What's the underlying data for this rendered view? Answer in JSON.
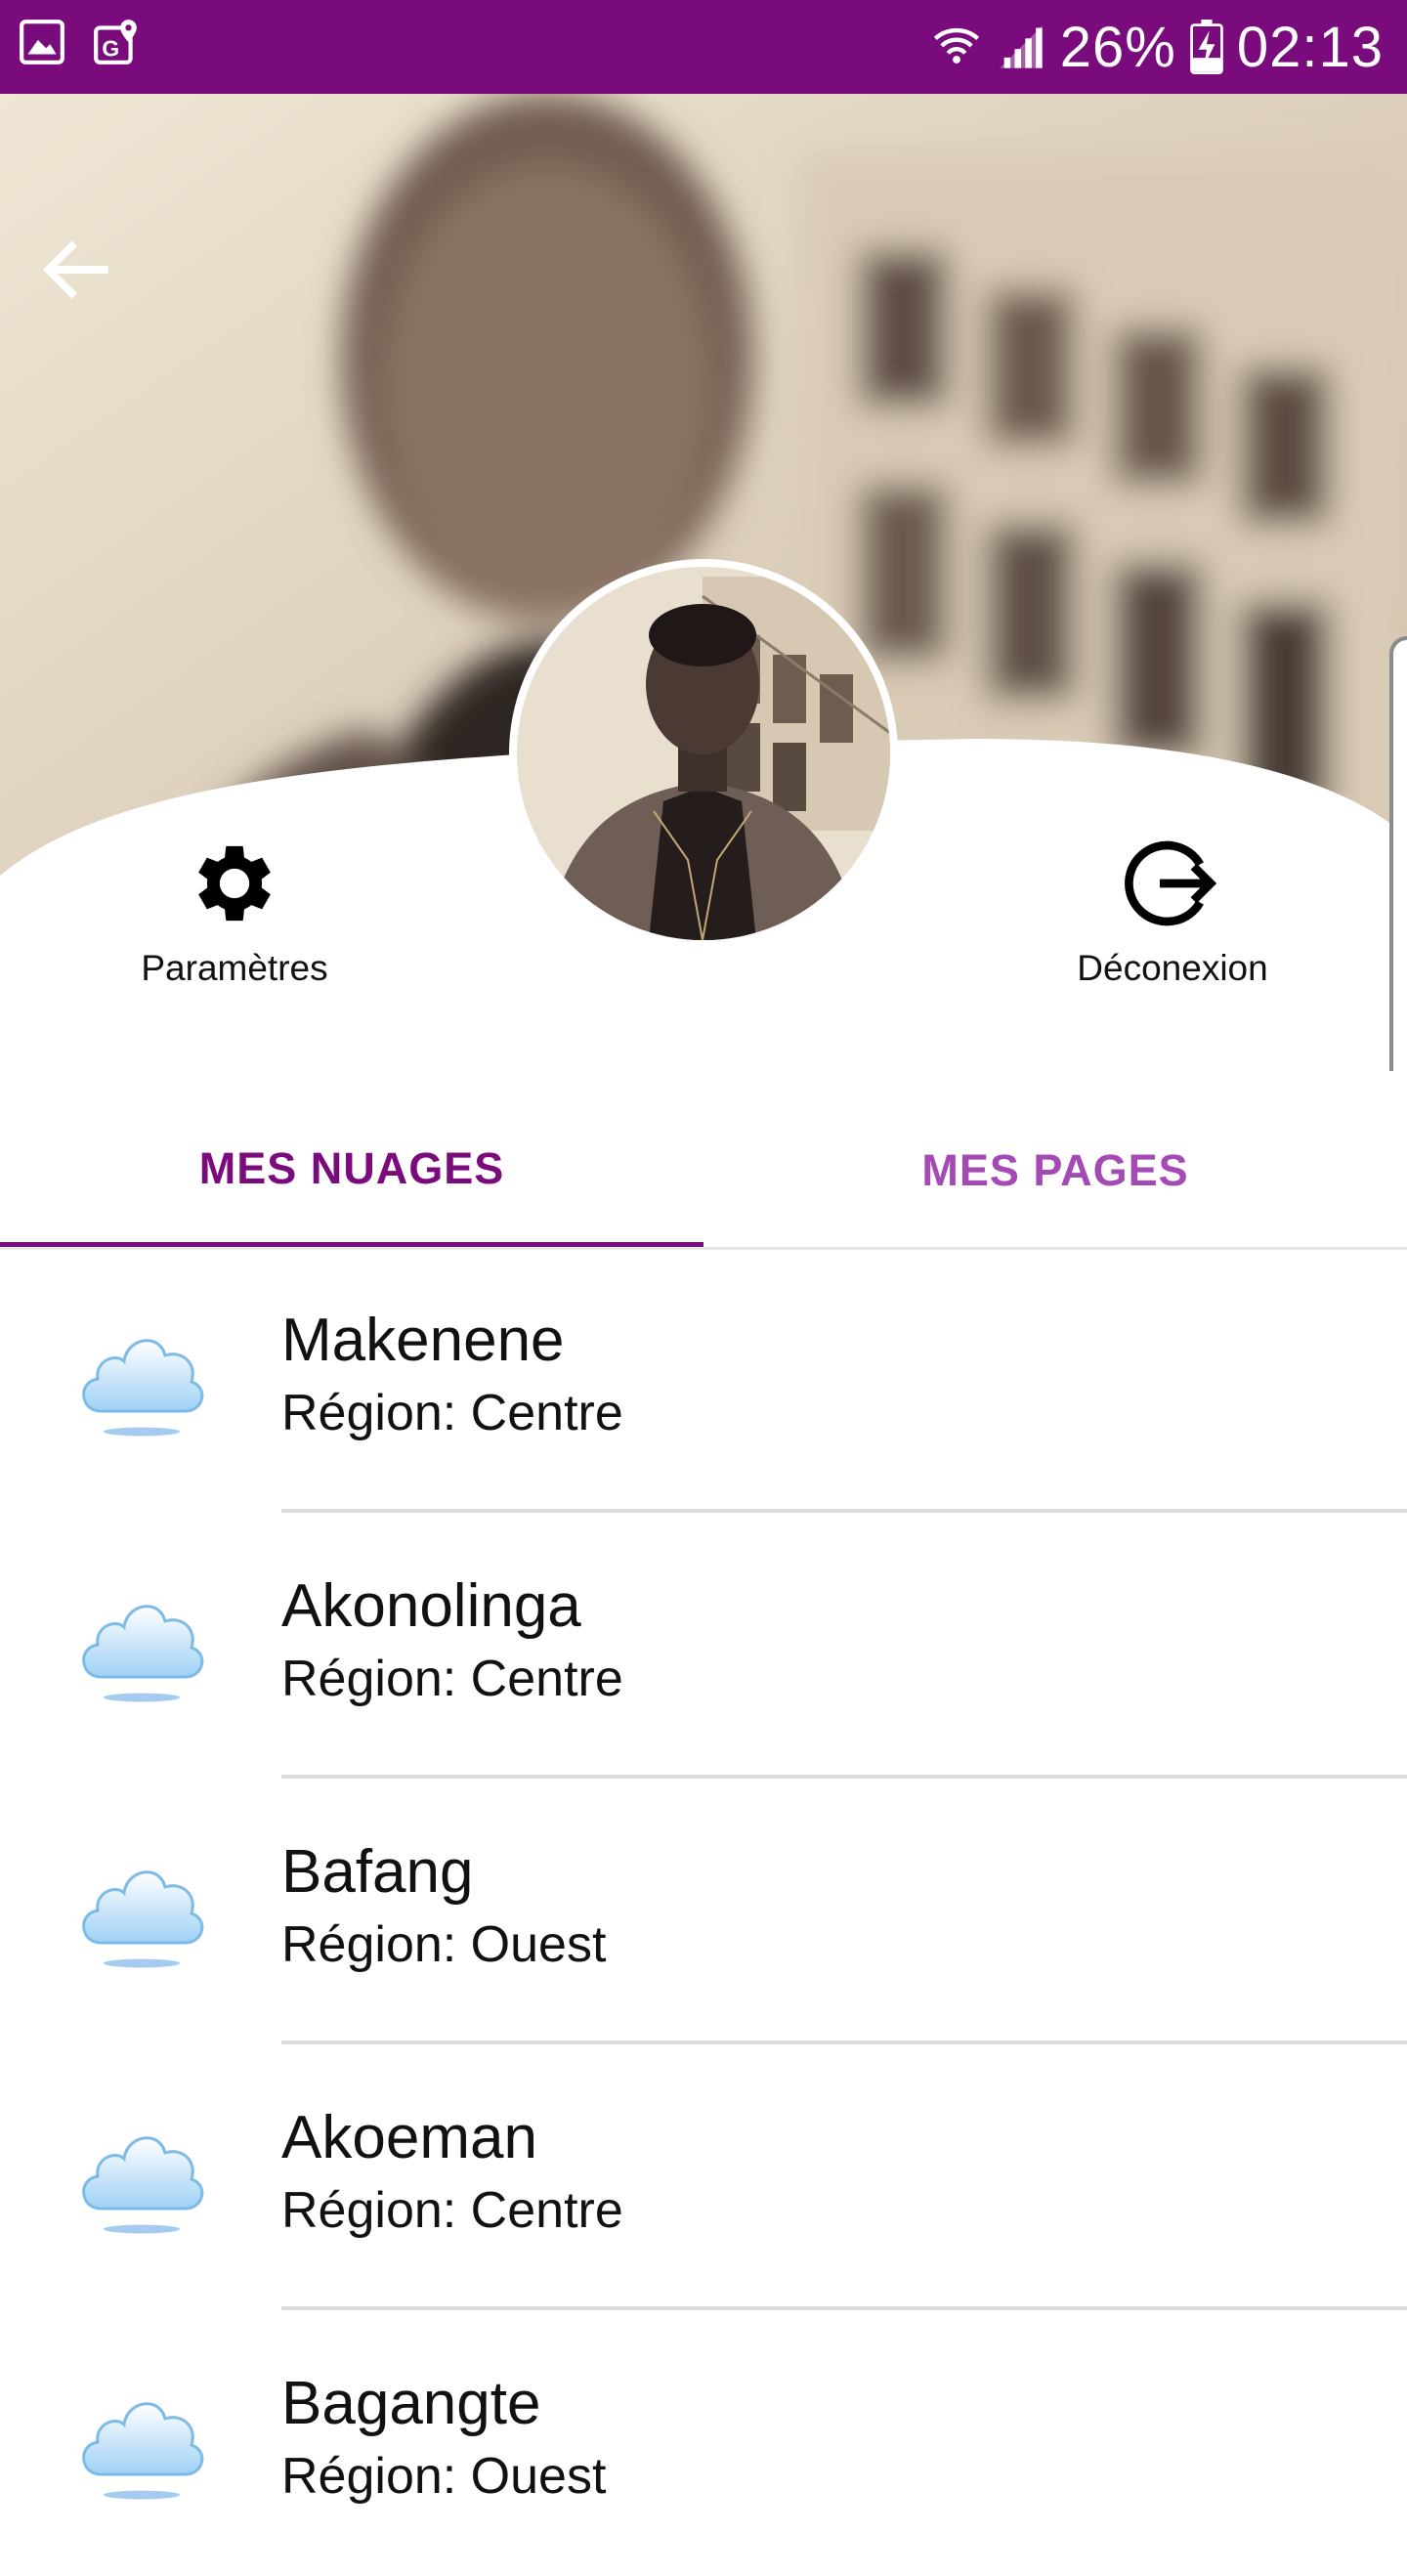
{
  "status_bar": {
    "battery": "26%",
    "time": "02:13",
    "icons": [
      "gallery-icon",
      "maps-icon",
      "wifi-icon",
      "signal-icon",
      "battery-charging-icon"
    ]
  },
  "header": {
    "back_icon": "arrow-left-icon"
  },
  "actions": {
    "settings_label": "Paramètres",
    "logout_label": "Déconexion"
  },
  "tabs": [
    {
      "label": "MES NUAGES",
      "active": true
    },
    {
      "label": "MES PAGES",
      "active": false
    }
  ],
  "colors": {
    "primary": "#7a0b7c",
    "tab_inactive": "#a44ab4",
    "divider": "#dddddd"
  },
  "clouds": [
    {
      "name": "Makenene",
      "region": "Région: Centre"
    },
    {
      "name": "Akonolinga",
      "region": "Région: Centre"
    },
    {
      "name": "Bafang",
      "region": "Région: Ouest"
    },
    {
      "name": "Akoeman",
      "region": "Région: Centre"
    },
    {
      "name": "Bagangte",
      "region": "Région: Ouest"
    }
  ]
}
